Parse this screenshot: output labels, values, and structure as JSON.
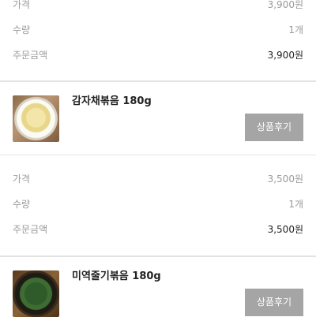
{
  "items": [
    {
      "price_label": "가격",
      "price": "3,900원",
      "qty_label": "수량",
      "qty": "1개",
      "total_label": "주문금액",
      "total": "3,900원"
    },
    {
      "name": "감자채볶음 180g",
      "review_button": "상품후기",
      "price_label": "가격",
      "price": "3,500원",
      "qty_label": "수량",
      "qty": "1개",
      "total_label": "주문금액",
      "total": "3,500원"
    },
    {
      "name": "미역줄기볶음 180g",
      "review_button": "상품후기"
    }
  ]
}
